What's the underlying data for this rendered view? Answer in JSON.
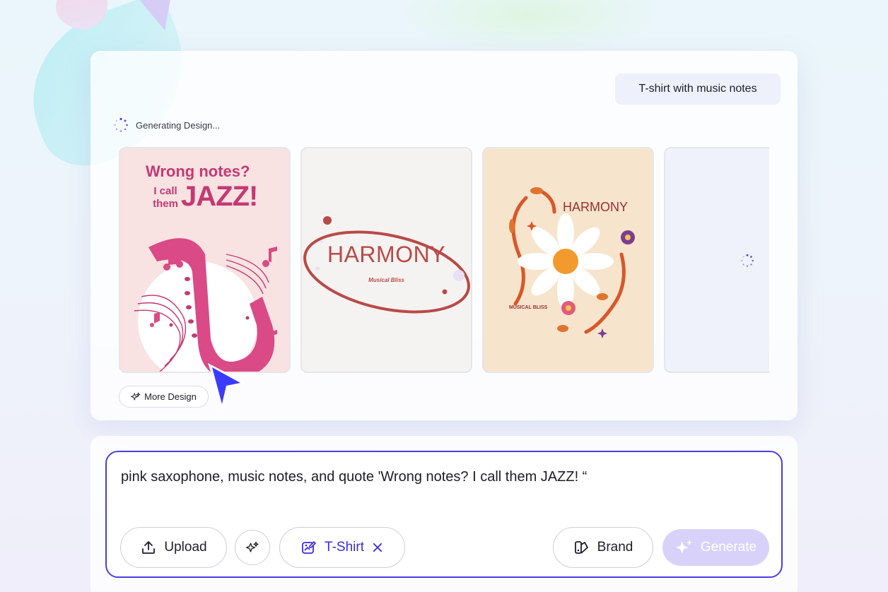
{
  "results_panel": {
    "prompt_chip": "T-shirt with music notes",
    "status_text": "Generating Design...",
    "more_design_label": "More Design",
    "designs": [
      {
        "title_line1": "Wrong notes?",
        "title_small": "I call them",
        "title_big": "JAZZ!"
      },
      {
        "title": "HARMONY",
        "subtitle": "Musical Bliss"
      },
      {
        "title": "HARMONY",
        "subtitle": "MUSICAL BLISS"
      }
    ]
  },
  "composer": {
    "prompt_text": "pink saxophone, music notes, and quote 'Wrong notes? I call them JAZZ! “",
    "upload_label": "Upload",
    "tshirt_label": "T-Shirt",
    "brand_label": "Brand",
    "generate_label": "Generate"
  },
  "colors": {
    "accent": "#4b3fe0",
    "generate_bg": "#d8d2fb",
    "cursor": "#3b3bff"
  },
  "icons": {
    "spinner": "loading-spinner-icon",
    "upload": "upload-icon",
    "magic": "sparkles-icon",
    "tshirt": "image-edit-icon",
    "close": "close-icon",
    "brand": "brand-palette-icon",
    "generate": "sparkles-icon",
    "cursor": "pointer-cursor-icon"
  }
}
